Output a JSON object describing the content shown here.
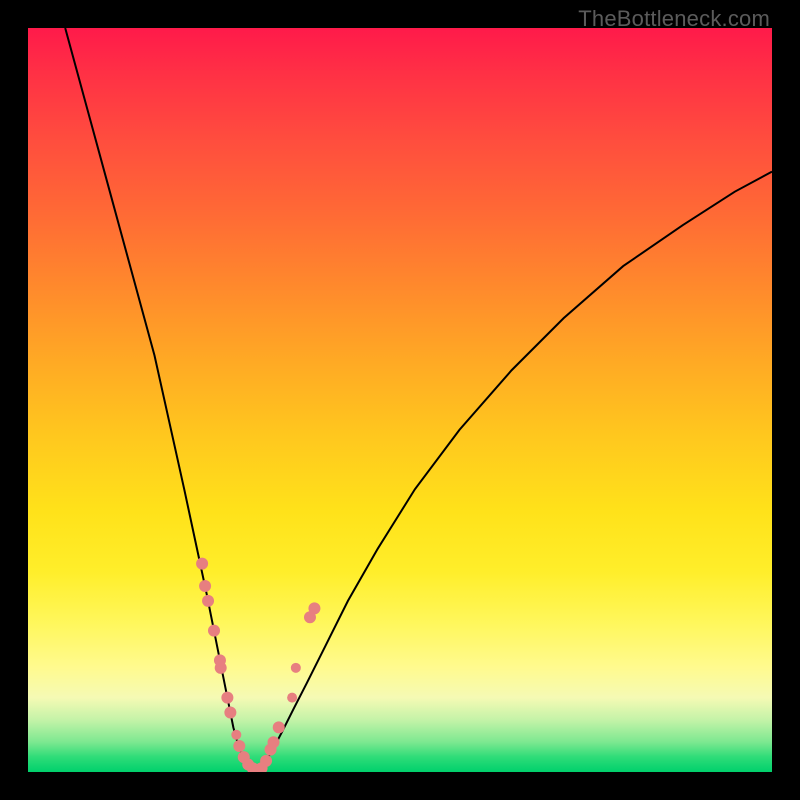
{
  "watermark": "TheBottleneck.com",
  "chart_data": {
    "type": "line",
    "title": "",
    "xlabel": "",
    "ylabel": "",
    "xlim": [
      0,
      100
    ],
    "ylim": [
      0,
      100
    ],
    "series": [
      {
        "name": "left-branch",
        "x": [
          5,
          8,
          11,
          14,
          17,
          19,
          21,
          22.5,
          24,
          25.2,
          26.2,
          27,
          27.6,
          28.2,
          28.8,
          29.4,
          30,
          30.6
        ],
        "y": [
          100,
          89,
          78,
          67,
          56,
          47,
          38,
          31,
          24,
          18,
          13,
          9,
          6,
          3.8,
          2.2,
          1.2,
          0.5,
          0.1
        ]
      },
      {
        "name": "right-branch",
        "x": [
          30.6,
          31.2,
          32,
          33,
          34.2,
          35.7,
          37.5,
          40,
          43,
          47,
          52,
          58,
          65,
          72,
          80,
          88,
          95,
          100
        ],
        "y": [
          0.1,
          0.5,
          1.5,
          3.2,
          5.5,
          8.5,
          12,
          17,
          23,
          30,
          38,
          46,
          54,
          61,
          68,
          73.5,
          78,
          80.7
        ]
      }
    ],
    "scatter": {
      "name": "data-points",
      "color": "#e77f80",
      "points": [
        {
          "x": 23.4,
          "y": 28,
          "r": 6
        },
        {
          "x": 23.8,
          "y": 25,
          "r": 6
        },
        {
          "x": 24.2,
          "y": 23,
          "r": 6
        },
        {
          "x": 25.0,
          "y": 19,
          "r": 6
        },
        {
          "x": 25.8,
          "y": 15,
          "r": 6
        },
        {
          "x": 25.9,
          "y": 14,
          "r": 6
        },
        {
          "x": 26.8,
          "y": 10,
          "r": 6
        },
        {
          "x": 27.2,
          "y": 8,
          "r": 6
        },
        {
          "x": 28.0,
          "y": 5,
          "r": 5
        },
        {
          "x": 28.4,
          "y": 3.5,
          "r": 6
        },
        {
          "x": 29.0,
          "y": 2,
          "r": 6
        },
        {
          "x": 29.6,
          "y": 1,
          "r": 6
        },
        {
          "x": 30.2,
          "y": 0.5,
          "r": 6
        },
        {
          "x": 30.8,
          "y": 0.3,
          "r": 6
        },
        {
          "x": 31.4,
          "y": 0.5,
          "r": 6
        },
        {
          "x": 32.0,
          "y": 1.5,
          "r": 6
        },
        {
          "x": 32.6,
          "y": 3,
          "r": 6
        },
        {
          "x": 33.0,
          "y": 4,
          "r": 6
        },
        {
          "x": 33.7,
          "y": 6,
          "r": 6
        },
        {
          "x": 35.5,
          "y": 10,
          "r": 5
        },
        {
          "x": 36.0,
          "y": 14,
          "r": 5
        },
        {
          "x": 37.9,
          "y": 20.8,
          "r": 6
        },
        {
          "x": 38.5,
          "y": 22,
          "r": 6
        }
      ]
    }
  }
}
